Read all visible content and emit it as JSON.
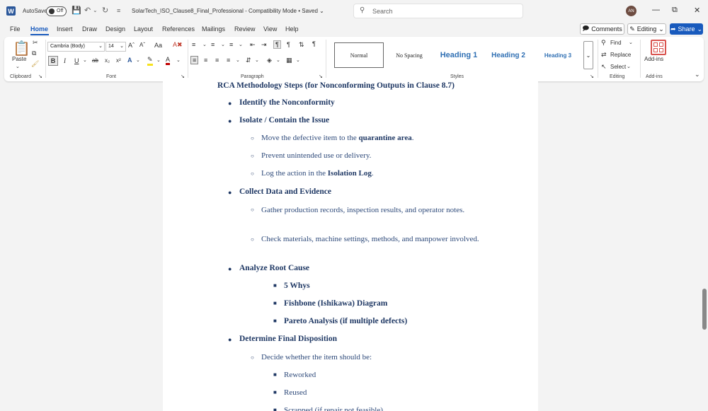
{
  "titlebar": {
    "autosave_label": "AutoSave",
    "autosave_state": "Off",
    "document_title": "SolarTech_ISO_Clause8_Final_Professional  -  Compatibility Mode • Saved ⌄",
    "search_placeholder": "Search",
    "avatar_initials": "AN"
  },
  "menu": {
    "tabs": [
      "File",
      "Home",
      "Insert",
      "Draw",
      "Design",
      "Layout",
      "References",
      "Mailings",
      "Review",
      "View",
      "Help"
    ],
    "active_tab": "Home",
    "comments_label": "Comments",
    "editing_label": "Editing",
    "share_label": "Share"
  },
  "ribbon": {
    "clipboard": {
      "paste_label": "Paste",
      "group_label": "Clipboard"
    },
    "font": {
      "font_name": "Cambria (Body)",
      "font_size": "14",
      "group_label": "Font"
    },
    "paragraph": {
      "group_label": "Paragraph"
    },
    "styles": {
      "items": [
        "Normal",
        "No Spacing",
        "Heading 1",
        "Heading 2",
        "Heading 3"
      ],
      "group_label": "Styles"
    },
    "editing": {
      "find_label": "Find",
      "replace_label": "Replace",
      "select_label": "Select",
      "group_label": "Editing"
    },
    "addins": {
      "button_label": "Add-ins",
      "group_label": "Add-ins"
    }
  },
  "document": {
    "heading": "RCA Methodology Steps (for Nonconforming Outputs in Clause 8.7)",
    "steps": {
      "s1": "Identify the Nonconformity",
      "s2": "Isolate / Contain the Issue",
      "s2_a_pre": "Move the defective item to the ",
      "s2_a_bold": "quarantine area",
      "s2_a_post": ".",
      "s2_b": "Prevent unintended use or delivery.",
      "s2_c_pre": "Log the action in the ",
      "s2_c_bold": "Isolation Log",
      "s2_c_post": ".",
      "s3": "Collect Data and Evidence",
      "s3_a": "Gather production records, inspection results, and operator notes.",
      "s3_b": "Check materials, machine settings, methods, and manpower involved.",
      "s4": "Analyze Root Cause",
      "s4_a": "5 Whys",
      "s4_b": "Fishbone (Ishikawa) Diagram",
      "s4_c": "Pareto Analysis (if multiple defects)",
      "s5": "Determine Final Disposition",
      "s5_a": "Decide whether the item should be:",
      "s5_a1": "Reworked",
      "s5_a2": "Reused",
      "s5_a3": "Scrapped (if repair not feasible)"
    }
  }
}
